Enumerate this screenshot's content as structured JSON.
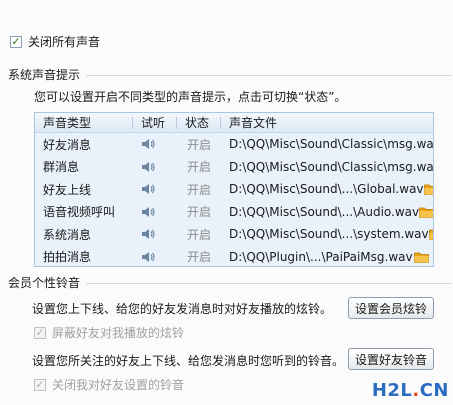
{
  "top": {
    "mute_all": {
      "label": "关闭所有声音",
      "checked": true
    }
  },
  "system_sounds": {
    "title": "系统声音提示",
    "desc": "您可以设置开启不同类型的声音提示，点击可切换“状态”。",
    "columns": [
      "声音类型",
      "试听",
      "状态",
      "声音文件"
    ],
    "rows": [
      {
        "type": "好友消息",
        "status": "开启",
        "file": "D:\\QQ\\Misc\\Sound\\Classic\\msg.wav"
      },
      {
        "type": "群消息",
        "status": "开启",
        "file": "D:\\QQ\\Misc\\Sound\\Classic\\msg.wav"
      },
      {
        "type": "好友上线",
        "status": "开启",
        "file": "D:\\QQ\\Misc\\Sound\\...\\Global.wav"
      },
      {
        "type": "语音视频呼叫",
        "status": "开启",
        "file": "D:\\QQ\\Misc\\Sound\\...\\Audio.wav"
      },
      {
        "type": "系统消息",
        "status": "开启",
        "file": "D:\\QQ\\Misc\\Sound\\...\\system.wav"
      },
      {
        "type": "拍拍消息",
        "status": "开启",
        "file": "D:\\QQ\\Plugin\\...\\PaiPaiMsg.wav"
      }
    ]
  },
  "member_ringtone": {
    "title": "会员个性铃音",
    "desc1": "设置您上下线、给您的好友发消息时对好友播放的炫铃。",
    "btn1": "设置会员炫铃",
    "block_label": "屏蔽好友对我播放的炫铃",
    "desc2": "设置您所关注的好友上下线、给您发消息时您听到的铃音。",
    "btn2": "设置好友铃音",
    "close_label": "关闭我对好友设置的铃音"
  },
  "watermark": {
    "a": "H2L",
    "dot": ".",
    "b": "CN"
  },
  "colors": {
    "table_bg": "#e9f1fa",
    "table_border": "#a9c7e3",
    "folder": "#e8a317",
    "speaker": "#6a86a3"
  }
}
